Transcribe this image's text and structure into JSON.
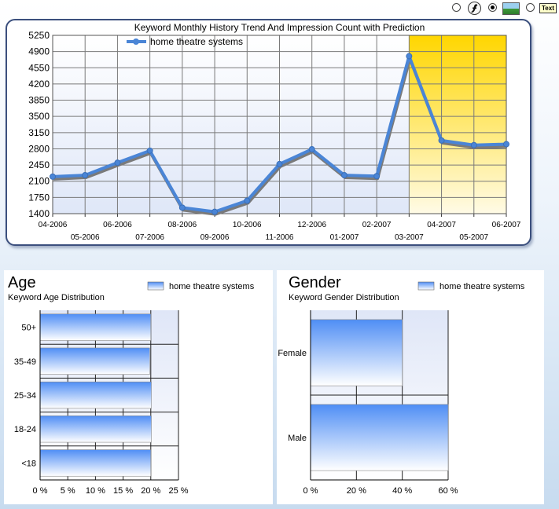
{
  "toolbar": {
    "radio_1": "unselected",
    "flash_icon": "flash-icon",
    "radio_2": "selected",
    "image_icon": "image-icon",
    "radio_3": "unselected",
    "text_button_label": "Text"
  },
  "colors": {
    "line": "#4a85d6",
    "line_shadow": "#7a7a7a",
    "prediction_fill_top": "#ffd600",
    "prediction_fill_bottom": "#fffbe6",
    "bar_top": "#4f8ef5",
    "bar_bottom": "#ffffff",
    "panel_border": "#3b4f7d"
  },
  "chart_data": [
    {
      "type": "line",
      "title": "Keyword Monthly History Trend And Impression Count with Prediction",
      "xlabel": "",
      "ylabel": "",
      "categories": [
        "04-2006",
        "05-2006",
        "06-2006",
        "07-2006",
        "08-2006",
        "09-2006",
        "10-2006",
        "11-2006",
        "12-2006",
        "01-2007",
        "02-2007",
        "03-2007",
        "04-2007",
        "05-2007",
        "06-2007"
      ],
      "series": [
        {
          "name": "home theatre systems",
          "values": [
            2200,
            2230,
            2500,
            2760,
            1530,
            1440,
            1680,
            2470,
            2790,
            2230,
            2210,
            4800,
            2980,
            2880,
            2900
          ]
        }
      ],
      "ylim": [
        1400,
        5250
      ],
      "yticks": [
        "5250",
        "4900",
        "4550",
        "4200",
        "3850",
        "3500",
        "3150",
        "2800",
        "2450",
        "2100",
        "1750",
        "1400"
      ],
      "prediction_start": "03-2007",
      "prediction_end": "06-2007",
      "grid": true,
      "legend_position": "top-left"
    },
    {
      "type": "bar",
      "orientation": "horizontal",
      "title": "Age",
      "subtitle": "Keyword Age Distribution",
      "categories": [
        "50+",
        "35-49",
        "25-34",
        "18-24",
        "<18"
      ],
      "series": [
        {
          "name": "home theatre systems",
          "values": [
            20,
            19.8,
            20.1,
            20.1,
            20
          ]
        }
      ],
      "xlim": [
        0,
        25
      ],
      "xticks": [
        "0 %",
        "5 %",
        "10 %",
        "15 %",
        "20 %",
        "25 %"
      ],
      "grid": true,
      "legend_position": "top-right"
    },
    {
      "type": "bar",
      "orientation": "horizontal",
      "title": "Gender",
      "subtitle": "Keyword Gender Distribution",
      "categories": [
        "Female",
        "Male"
      ],
      "series": [
        {
          "name": "home theatre systems",
          "values": [
            40,
            60
          ]
        }
      ],
      "xlim": [
        0,
        60
      ],
      "xticks": [
        "0 %",
        "20 %",
        "40 %",
        "60 %"
      ],
      "grid": true,
      "legend_position": "top-right"
    }
  ]
}
